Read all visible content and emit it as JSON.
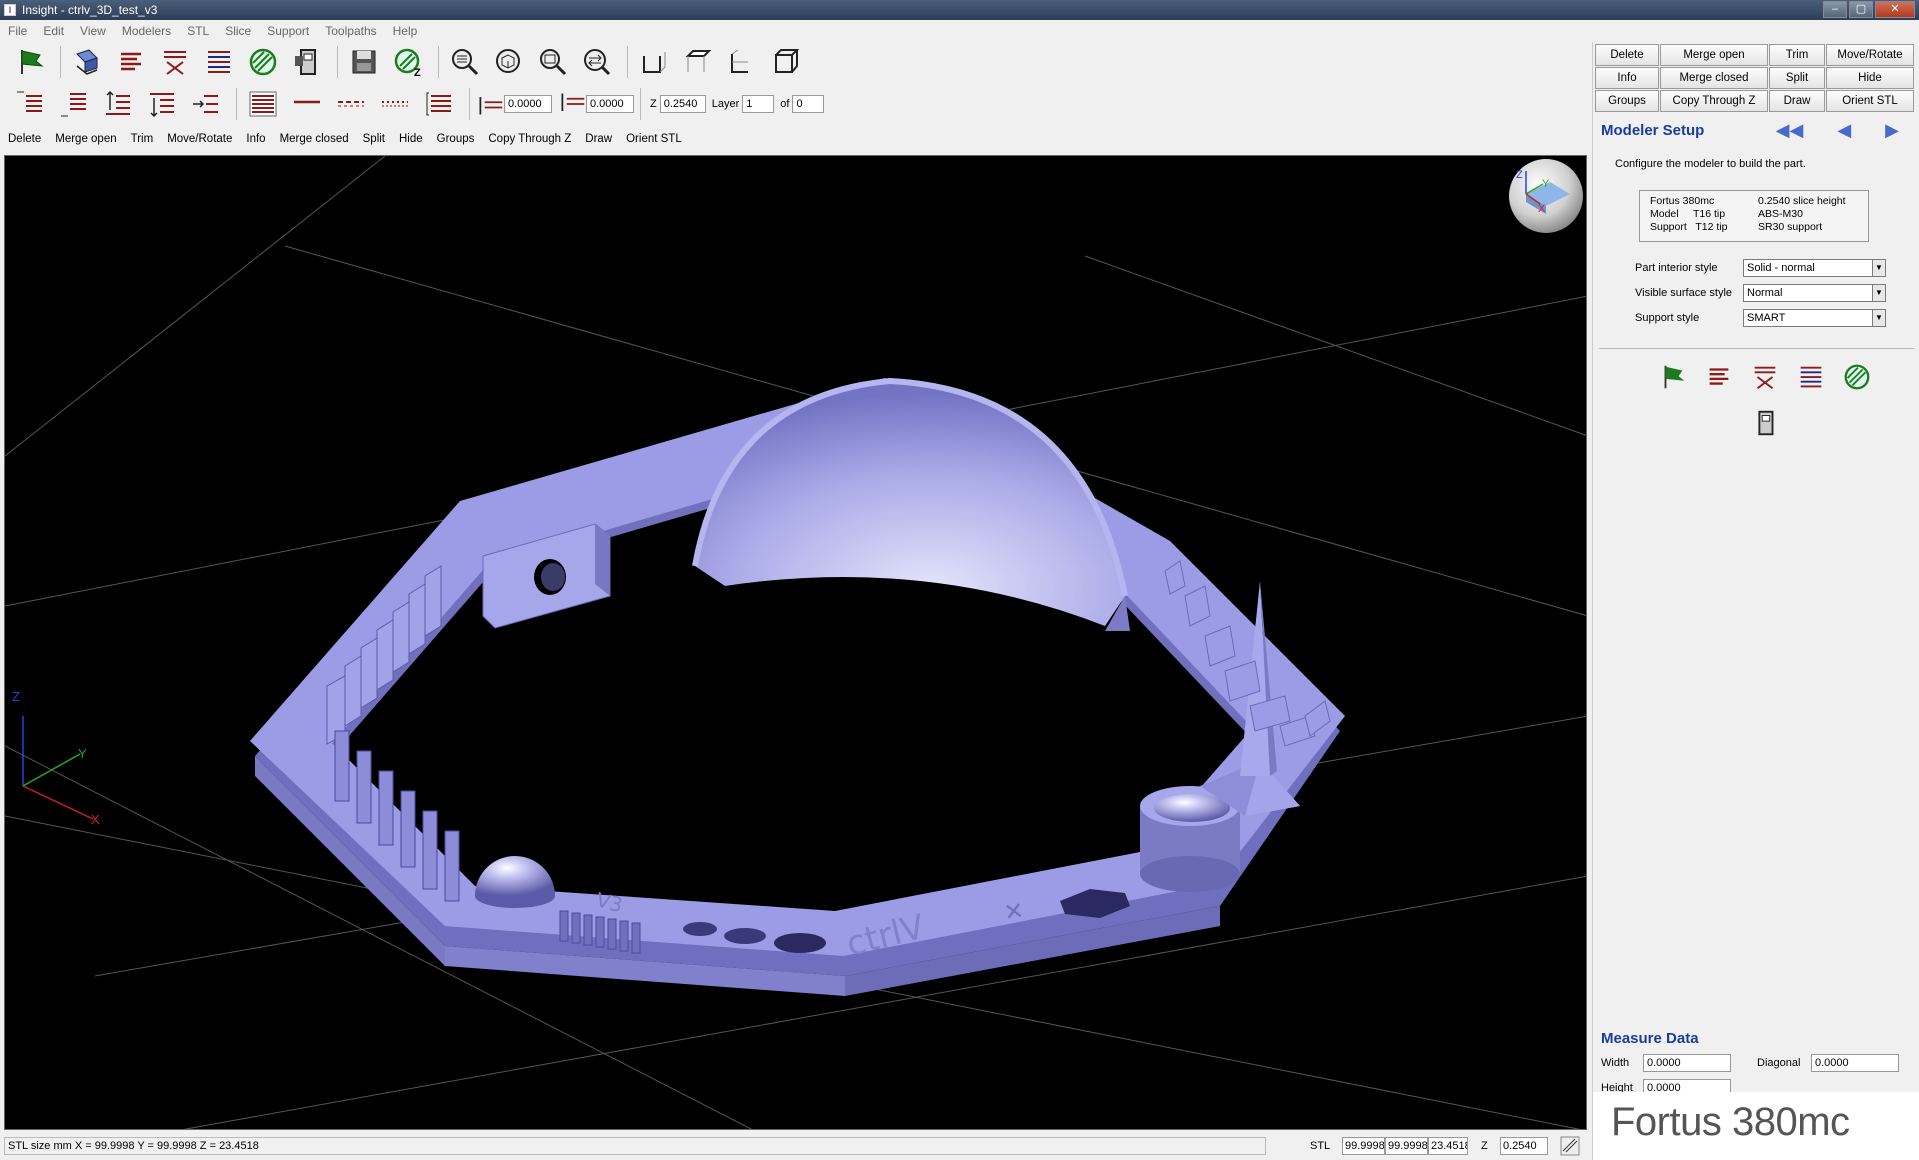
{
  "window": {
    "title": "Insight - ctrlv_3D_test_v3",
    "controls": [
      "–",
      "▢",
      "✕"
    ]
  },
  "menu": [
    "File",
    "Edit",
    "View",
    "Modelers",
    "STL",
    "Slice",
    "Support",
    "Toolpaths",
    "Help"
  ],
  "toolbar2": {
    "offset1": "0.0000",
    "offset2": "0.0000",
    "z_label": "Z",
    "z_value": "0.2540",
    "layer_label": "Layer",
    "layer_value": "1",
    "of_label": "of",
    "of_value": "0"
  },
  "commands": [
    "Delete",
    "Merge open",
    "Trim",
    "Move/Rotate",
    "Info",
    "Merge closed",
    "Split",
    "Hide",
    "Groups",
    "Copy Through Z",
    "Draw",
    "Orient STL"
  ],
  "viewport": {
    "axes": {
      "x": "X",
      "y": "Y",
      "z": "Z"
    },
    "model_text": [
      "ctrlV",
      "V3"
    ]
  },
  "status": {
    "stl_size": "STL size mm  X = 99.9998  Y = 99.9998  Z = 23.4518",
    "stl_label": "STL",
    "x": "99.9998",
    "y": "99.9998",
    "z": "23.4518",
    "z_label": "Z",
    "slice_z": "0.2540"
  },
  "panel": {
    "grid": [
      "Delete",
      "Merge open",
      "Trim",
      "Move/Rotate",
      "Info",
      "Merge closed",
      "Split",
      "Hide",
      "Groups",
      "Copy Through Z",
      "Draw",
      "Orient STL"
    ],
    "setup_title": "Modeler Setup",
    "setup_desc": "Configure the modeler to build the part.",
    "machine": {
      "r1c1": "Fortus 380mc",
      "r1c2": "0.2540 slice height",
      "r2c1": "Model     T16 tip",
      "r2c2": "ABS-M30",
      "r3c1": "Support   T12 tip",
      "r3c2": "SR30 support"
    },
    "options": [
      {
        "label": "Part interior style",
        "value": "Solid - normal"
      },
      {
        "label": "Visible surface style",
        "value": "Normal"
      },
      {
        "label": "Support style",
        "value": "SMART"
      }
    ],
    "measure_title": "Measure Data",
    "width_label": "Width",
    "width_value": "0.0000",
    "diagonal_label": "Diagonal",
    "diagonal_value": "0.0000",
    "height_label": "Height",
    "height_value": "0.0000",
    "brand": "Fortus 380mc"
  },
  "colors": {
    "model": "#9c9ce6",
    "viewport_bg": "#000000",
    "accent": "#1a3c9c",
    "icon_red": "#8b1a1a",
    "icon_green": "#1f7a1f"
  }
}
